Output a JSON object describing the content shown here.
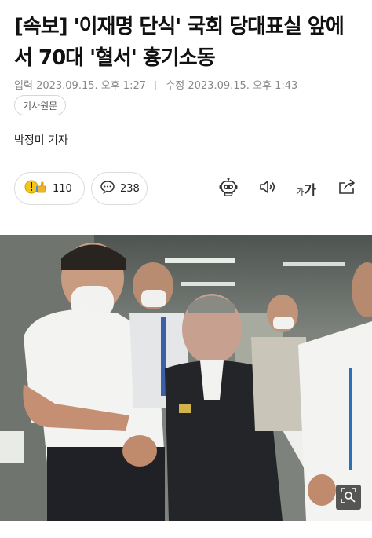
{
  "article": {
    "headline": "[속보] '이재명 단식' 국회 당대표실 앞에서 70대 '혈서' 흉기소동",
    "published_label": "입력",
    "published": "2023.09.15. 오후 1:27",
    "updated_label": "수정",
    "updated": "2023.09.15. 오후 1:43",
    "origin_button": "기사원문",
    "reporter": "박정미 기자"
  },
  "actions": {
    "reaction_count": "110",
    "comment_count": "238",
    "font_size_label_small": "가",
    "font_size_label_large": "가"
  },
  "icons": {
    "reaction": "reaction-emoji-icon",
    "comment": "comment-bubble-icon",
    "summary_bot": "robot-icon",
    "audio": "speaker-icon",
    "font": "font-size-icon",
    "share": "share-icon",
    "zoom": "zoom-icon"
  },
  "colors": {
    "headline": "#111111",
    "meta": "#888888",
    "border": "#dcdcdc"
  }
}
